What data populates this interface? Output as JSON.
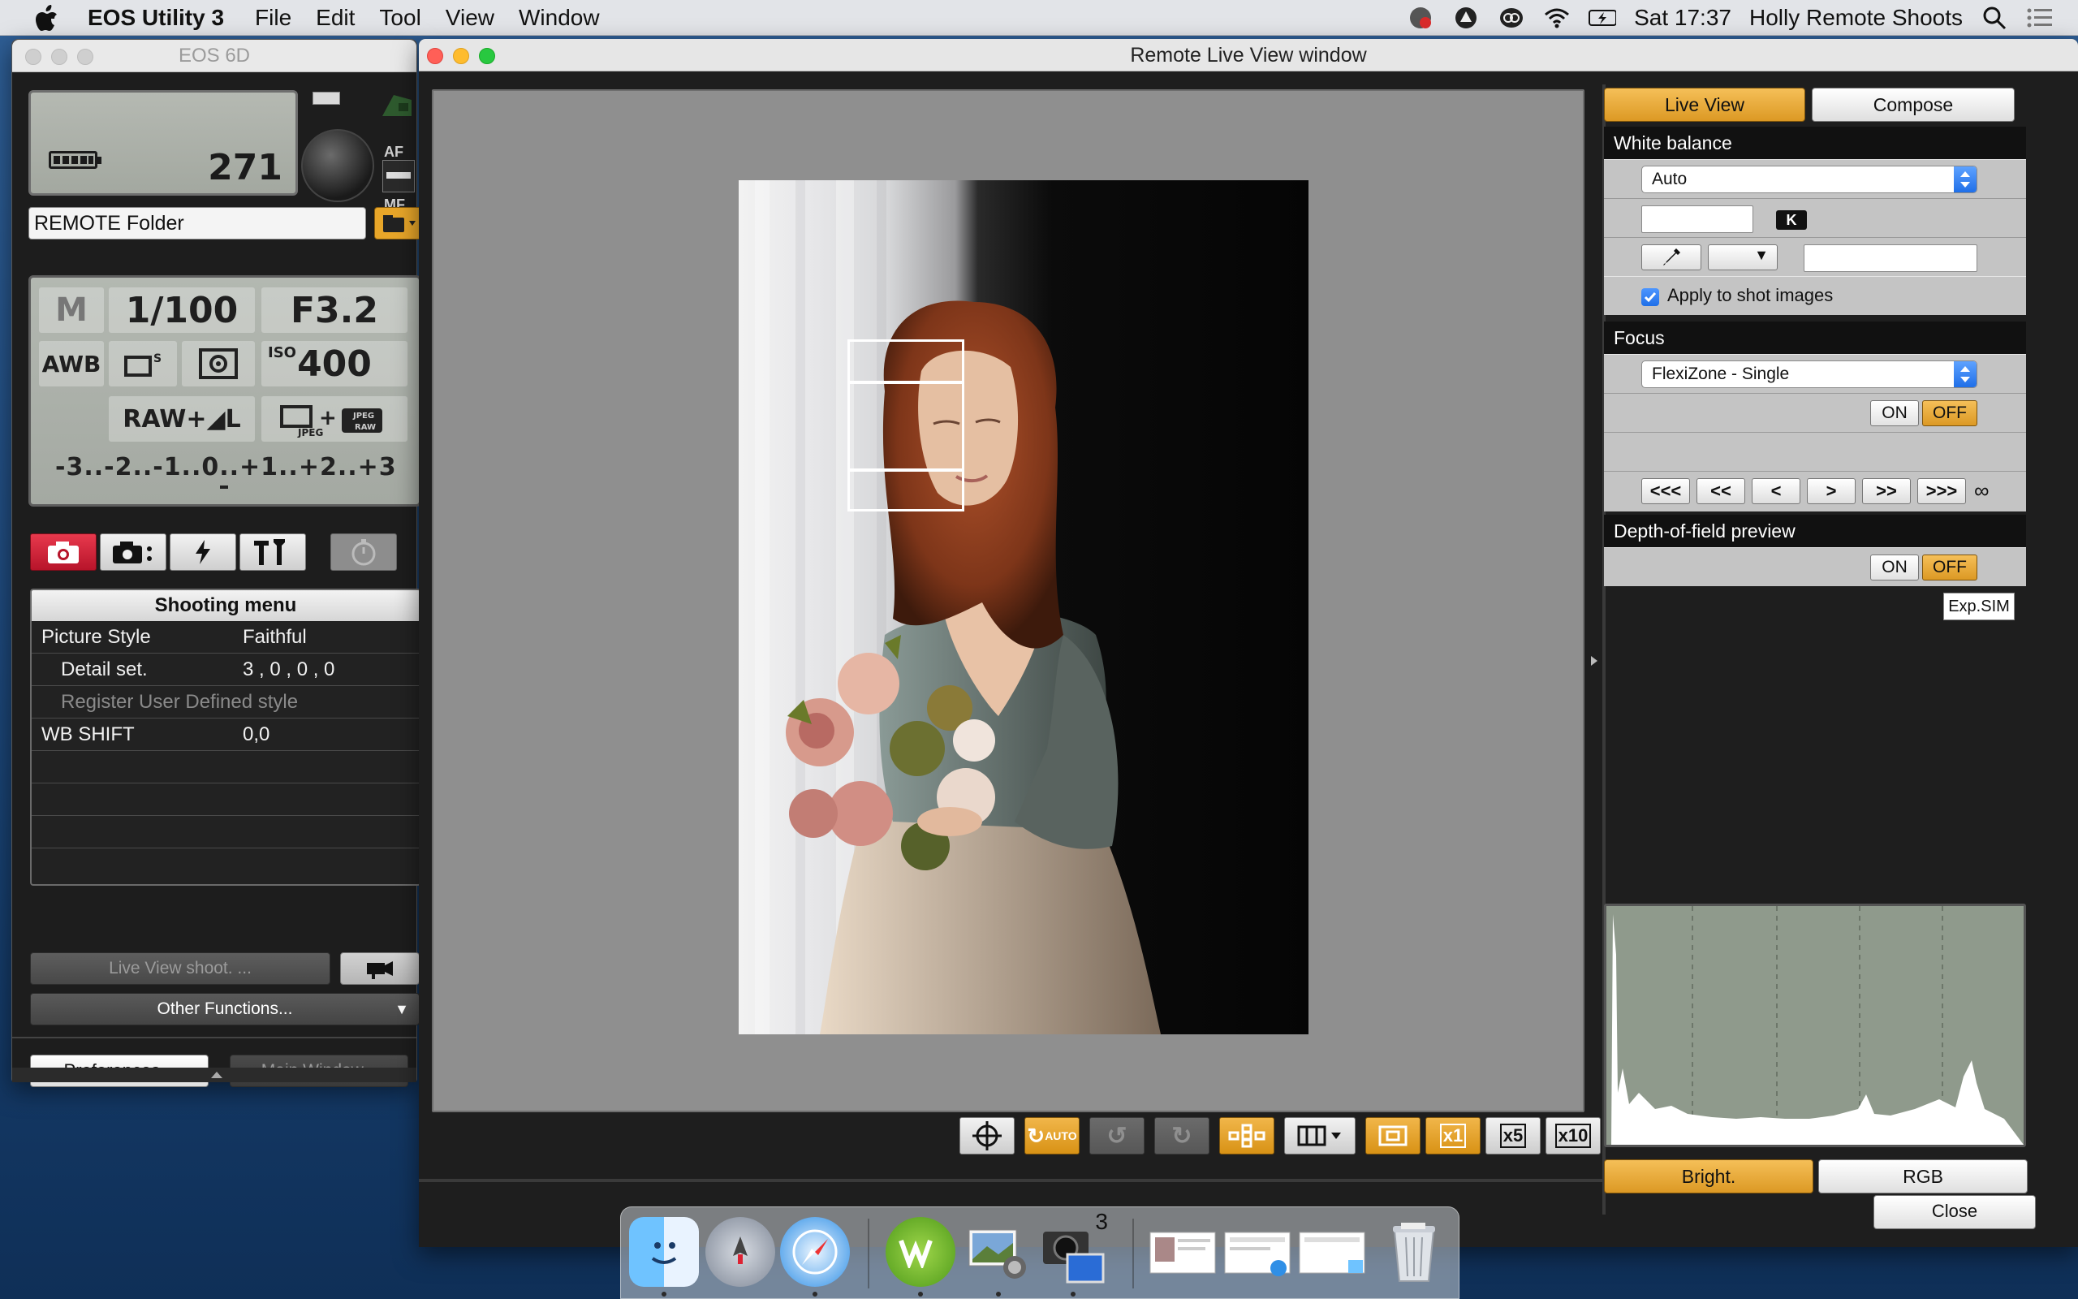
{
  "menubar": {
    "app_name": "EOS Utility 3",
    "menus": [
      "File",
      "Edit",
      "Tool",
      "View",
      "Window"
    ],
    "clock": "Sat 17:37",
    "user": "Holly Remote Shoots"
  },
  "camera_window": {
    "title": "EOS 6D",
    "shots_remaining": "271",
    "af_label": "AF",
    "mf_label": "MF",
    "folder": "REMOTE Folder",
    "mode": "M",
    "shutter": "1/100",
    "aperture": "F3.2",
    "wb": "AWB",
    "iso_label": "ISO",
    "iso": "400",
    "quality": "RAW+◢L",
    "exposure_scale": "-3..-2..-1..0..+1..+2..+3",
    "shooting_menu": {
      "title": "Shooting menu",
      "rows": [
        {
          "key": "Picture Style",
          "value": "Faithful"
        },
        {
          "key": "Detail set.",
          "value": "3 , 0 , 0 , 0"
        },
        {
          "key": "Register User Defined style",
          "value": ""
        },
        {
          "key": "WB SHIFT",
          "value": "0,0"
        }
      ]
    },
    "live_view_shoot_label": "Live View shoot. ...",
    "other_functions_label": "Other Functions...",
    "preferences_label": "Preferences...",
    "main_window_label": "Main Window..."
  },
  "live_view_window": {
    "title": "Remote Live View window",
    "toolbar": {
      "auto_label": "AUTO",
      "zoom_x1": "x1",
      "zoom_x5": "x5",
      "zoom_x10": "x10"
    },
    "panel": {
      "live_view_tab": "Live View",
      "compose_tab": "Compose",
      "white_balance": {
        "title": "White balance",
        "mode": "Auto",
        "kelvin_value": "",
        "kelvin_unit": "K",
        "apply_label": "Apply to shot images",
        "apply_checked": true
      },
      "focus": {
        "title": "Focus",
        "mode": "FlexiZone - Single",
        "on_label": "ON",
        "off_label": "OFF",
        "nav": [
          "<<<",
          "<<",
          "<",
          ">",
          ">>",
          ">>>"
        ],
        "infinity": "∞"
      },
      "dof": {
        "title": "Depth-of-field preview",
        "on_label": "ON",
        "off_label": "OFF",
        "exp_sim": "Exp.SIM"
      },
      "histogram_mode": {
        "bright_label": "Bright.",
        "rgb_label": "RGB"
      }
    },
    "close_label": "Close"
  },
  "dock": {
    "badge_count": "3"
  },
  "colors": {
    "accent_orange": "#dc9924",
    "active_red_tab": "#b7142a",
    "lcd_green": "#a4a9a2",
    "histogram_bg": "#8f9a8c"
  }
}
